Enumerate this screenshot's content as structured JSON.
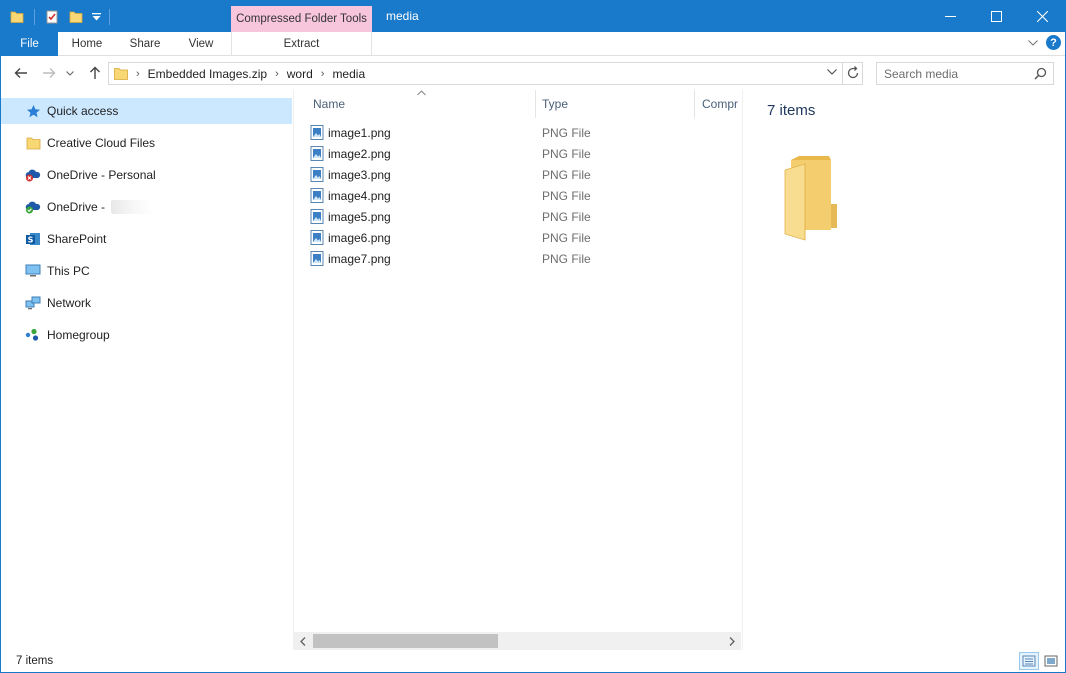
{
  "window": {
    "title": "media",
    "context_tab": "Compressed Folder Tools"
  },
  "ribbon": {
    "tabs": [
      "File",
      "Home",
      "Share",
      "View",
      "Extract"
    ]
  },
  "address": {
    "crumbs": [
      "Embedded Images.zip",
      "word",
      "media"
    ]
  },
  "search": {
    "placeholder": "Search media"
  },
  "nav": {
    "items": [
      {
        "label": "Quick access",
        "icon": "star-icon",
        "selected": true
      },
      {
        "label": "Creative Cloud Files",
        "icon": "folder-icon"
      },
      {
        "label": "OneDrive - Personal",
        "icon": "onedrive-error-icon"
      },
      {
        "label": "OneDrive -",
        "icon": "onedrive-icon"
      },
      {
        "label": "SharePoint",
        "icon": "sharepoint-icon"
      },
      {
        "label": "This PC",
        "icon": "computer-icon"
      },
      {
        "label": "Network",
        "icon": "network-icon"
      },
      {
        "label": "Homegroup",
        "icon": "homegroup-icon"
      }
    ]
  },
  "list": {
    "columns": [
      "Name",
      "Type",
      "Compr"
    ],
    "rows": [
      {
        "name": "image1.png",
        "type": "PNG File"
      },
      {
        "name": "image2.png",
        "type": "PNG File"
      },
      {
        "name": "image3.png",
        "type": "PNG File"
      },
      {
        "name": "image4.png",
        "type": "PNG File"
      },
      {
        "name": "image5.png",
        "type": "PNG File"
      },
      {
        "name": "image6.png",
        "type": "PNG File"
      },
      {
        "name": "image7.png",
        "type": "PNG File"
      }
    ]
  },
  "preview": {
    "count": "7 items"
  },
  "status": {
    "count": "7 items"
  },
  "colors": {
    "accent": "#1979ca",
    "context_tab": "#f7c5dc",
    "selected": "#cce8ff"
  }
}
